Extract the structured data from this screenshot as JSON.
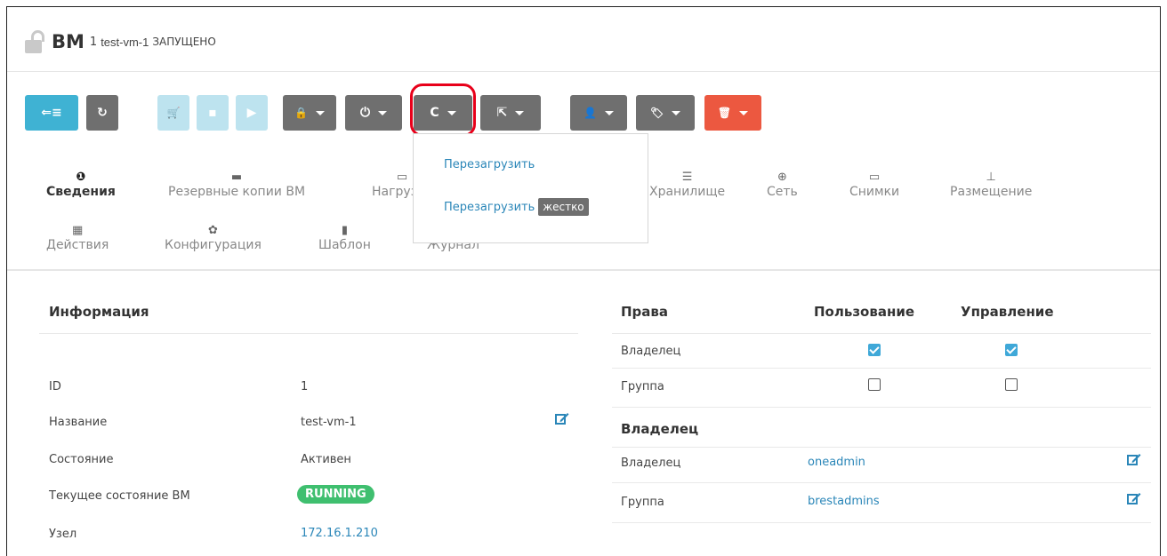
{
  "header": {
    "title": "ВМ",
    "vm_id": "1",
    "vm_name": "test-vm-1",
    "state": "ЗАПУЩЕНО",
    "lock_icon": "unlock-icon"
  },
  "toolbar": {
    "buttons": [
      {
        "name": "back-button",
        "icon": "back-list-icon",
        "glyph": "⇐≡"
      },
      {
        "name": "refresh-button",
        "icon": "refresh-icon",
        "glyph": "↻"
      },
      {
        "name": "deploy-button",
        "icon": "cart-icon",
        "glyph": "🛒"
      },
      {
        "name": "save-button",
        "icon": "save-icon",
        "glyph": "▪"
      },
      {
        "name": "play-button",
        "icon": "play-icon",
        "glyph": "▶"
      },
      {
        "name": "lock-dropdown",
        "icon": "lock-icon",
        "glyph": "🔒"
      },
      {
        "name": "power-dropdown",
        "icon": "power-icon",
        "glyph": "⏻"
      },
      {
        "name": "reboot-dropdown",
        "icon": "reboot-icon",
        "glyph": "C"
      },
      {
        "name": "migrate-dropdown",
        "icon": "share-icon",
        "glyph": "⇱"
      },
      {
        "name": "user-dropdown",
        "icon": "user-icon",
        "glyph": "👤"
      },
      {
        "name": "tag-dropdown",
        "icon": "tag-icon",
        "glyph": "🏷"
      },
      {
        "name": "delete-dropdown",
        "icon": "trash-icon",
        "glyph": "🗑"
      }
    ]
  },
  "reboot_menu": {
    "item1": "Перезагрузить",
    "item2": "Перезагрузить",
    "item2_tag": "жестко"
  },
  "tabs": [
    {
      "label": "Сведения",
      "icon": "info-icon",
      "glyph": "❶",
      "active": true
    },
    {
      "label": "Резервные копии ВМ",
      "icon": "archive-icon",
      "glyph": "▬"
    },
    {
      "label": "Нагрузка",
      "icon": "laptop-icon",
      "glyph": "▭"
    },
    {
      "label": "Хранилище",
      "icon": "storage-icon",
      "glyph": "☰"
    },
    {
      "label": "Сеть",
      "icon": "globe-icon",
      "glyph": "⊕"
    },
    {
      "label": "Снимки",
      "icon": "laptop-icon",
      "glyph": "▭"
    },
    {
      "label": "Размещение",
      "icon": "sitemap-icon",
      "glyph": "⊥"
    },
    {
      "label": "Действия",
      "icon": "calendar-icon",
      "glyph": "▦"
    },
    {
      "label": "Конфигурация",
      "icon": "cog-icon",
      "glyph": "✿"
    },
    {
      "label": "Шаблон",
      "icon": "file-icon",
      "glyph": "▮"
    },
    {
      "label": "Журнал",
      "icon": "log-icon",
      "glyph": ""
    }
  ],
  "info": {
    "title": "Информация",
    "rows": [
      {
        "label": "ID",
        "value": "1"
      },
      {
        "label": "Название",
        "value": "test-vm-1"
      },
      {
        "label": "Состояние",
        "value": "Активен"
      },
      {
        "label": "Текущее состояние ВМ",
        "value": "RUNNING"
      },
      {
        "label": "Узел",
        "value": "172.16.1.210"
      }
    ]
  },
  "perms": {
    "title": "Права",
    "col_use": "Пользование",
    "col_manage": "Управление",
    "rows": [
      {
        "label": "Владелец",
        "use": true,
        "manage": true
      },
      {
        "label": "Группа",
        "use": false,
        "manage": false
      }
    ]
  },
  "owner": {
    "title": "Владелец",
    "rows": [
      {
        "label": "Владелец",
        "value": "oneadmin"
      },
      {
        "label": "Группа",
        "value": "brestadmins"
      }
    ]
  },
  "colors": {
    "accent": "#3fb2d3",
    "link": "#2a86b8",
    "danger": "#ec5840",
    "running": "#3fbf6f",
    "highlight": "#e8001a"
  }
}
